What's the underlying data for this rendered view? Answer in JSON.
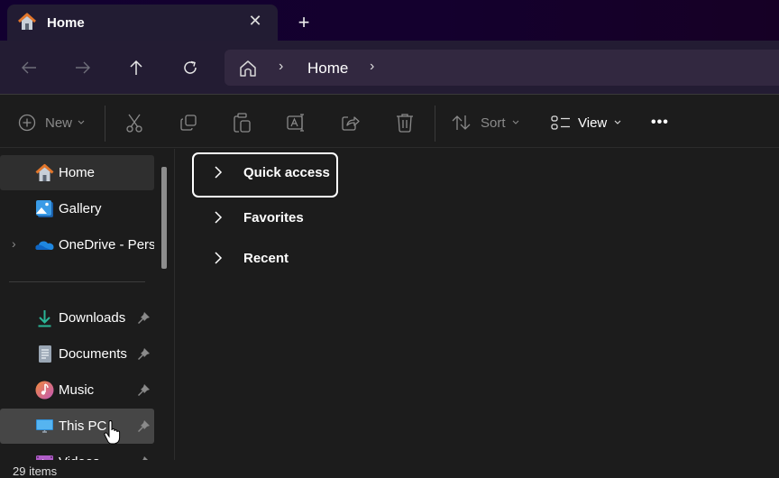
{
  "window": {
    "tab": {
      "title": "Home",
      "icon": "home-icon",
      "close": "✕"
    },
    "new_tab": "+"
  },
  "navigation": {
    "back": "back-arrow-icon",
    "forward": "forward-arrow-icon",
    "up": "up-arrow-icon",
    "refresh": "refresh-icon",
    "address": {
      "root_icon": "home-outline-icon",
      "separator": "›",
      "crumbs": [
        "Home"
      ]
    }
  },
  "toolbar": {
    "new_label": "New",
    "cut": "cut-icon",
    "copy": "copy-icon",
    "paste": "paste-icon",
    "rename": "rename-icon",
    "share": "share-icon",
    "delete": "delete-icon",
    "sort_label": "Sort",
    "view_label": "View",
    "more": "•••"
  },
  "sidebar": {
    "items": [
      {
        "label": "Home",
        "icon": "home-icon",
        "selected": true
      },
      {
        "label": "Gallery",
        "icon": "gallery-icon"
      },
      {
        "label": "OneDrive - Personal",
        "icon": "onedrive-icon",
        "expandable": true
      }
    ],
    "pinned": [
      {
        "label": "Downloads",
        "icon": "downloads-icon",
        "pinned": true
      },
      {
        "label": "Documents",
        "icon": "documents-icon",
        "pinned": true
      },
      {
        "label": "Music",
        "icon": "music-icon",
        "pinned": true
      },
      {
        "label": "This PC",
        "icon": "this-pc-icon",
        "pinned": true,
        "hovered": true
      },
      {
        "label": "Videos",
        "icon": "videos-icon",
        "pinned": true
      }
    ]
  },
  "content": {
    "groups": [
      {
        "label": "Quick access",
        "focused": true
      },
      {
        "label": "Favorites"
      },
      {
        "label": "Recent"
      }
    ]
  },
  "status": {
    "items_text": "29 items"
  },
  "colors": {
    "titlebar": "#120030",
    "tab": "#221c33",
    "address_bar": "#322840",
    "background": "#1c1c1c",
    "hover": "#464646",
    "selected": "#2f2f2f"
  }
}
